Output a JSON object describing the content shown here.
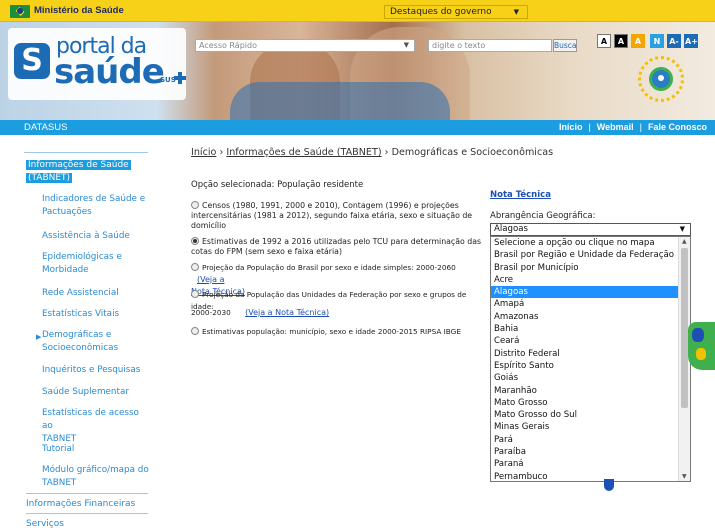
{
  "gov_bar": {
    "ministry": "Ministério da Saúde",
    "destaques": "Destaques do governo"
  },
  "header": {
    "logo_portal": "portal da",
    "logo_saude": "saúde",
    "logo_sus": "SUS",
    "search_placeholder": "Acesso Rápido",
    "digite_placeholder": "digite o texto",
    "busca_label": "Busca",
    "a11y": [
      "A",
      "A",
      "A",
      "N",
      "A-",
      "A+"
    ]
  },
  "datasus_bar": {
    "label": "DATASUS",
    "links": [
      "Início",
      "Webmail",
      "Fale Conosco"
    ]
  },
  "sidebar": {
    "main_item": [
      "Informações de Saúde",
      "(TABNET)"
    ],
    "items": [
      [
        "Indicadores de Saúde e",
        "Pactuações"
      ],
      [
        "Assistência à Saúde"
      ],
      [
        "Epidemiológicas e",
        "Morbidade"
      ],
      [
        "Rede Assistencial"
      ],
      [
        "Estatísticas Vitais"
      ],
      [
        "Demográficas e",
        "Socioeconômicas"
      ],
      [
        "Inquéritos e Pesquisas"
      ],
      [
        "Saúde Suplementar"
      ],
      [
        "Estatísticas de acesso ao",
        "TABNET"
      ],
      [
        "Tutorial"
      ],
      [
        "Módulo gráfico/mapa do",
        "TABNET"
      ]
    ],
    "financeiras": "Informações Financeiras",
    "servicos": "Serviços"
  },
  "breadcrumb": {
    "inicio": "Início",
    "sep": "›",
    "tabnet": "Informações de Saúde (TABNET)",
    "current": "Demográficas e Socioeconômicas"
  },
  "main": {
    "selected": "Opção selecionada: População residente",
    "options": [
      {
        "lines": [
          "Censos (1980, 1991, 2000 e 2010), Contagem (1996) e projeções",
          "intercensitárias (1981 a 2012), segundo faixa etária, sexo e situação de",
          "domicílio"
        ],
        "checked": false
      },
      {
        "lines": [
          "Estimativas de 1992 a 2016 utilizadas pelo TCU para determinação das",
          "cotas do FPM (sem sexo e faixa etária)"
        ],
        "checked": true
      },
      {
        "text": "Projeção da População do Brasil por sexo e idade simples: 2000-2060",
        "link": "(Veja a",
        "link2": "Nota Técnica)",
        "checked": false
      },
      {
        "text": "Projeção da População das Unidades da Federação por sexo e grupos de idade:",
        "text2": "2000-2030",
        "link": "(Veja a Nota Técnica)",
        "checked": false
      },
      {
        "text": "Estimativas população: município, sexo e idade 2000-2015 RIPSA IBGE",
        "checked": false
      }
    ],
    "nota_tecnica": "Nota Técnica",
    "abrangencia_label": "Abrangência Geográfica:",
    "select_value": "Alagoas",
    "dropdown": [
      "Selecione a opção ou clique no mapa",
      "Brasil por Região e Unidade da Federação",
      "Brasil por Município",
      "Acre",
      "Alagoas",
      "Amapá",
      "Amazonas",
      "Bahia",
      "Ceará",
      "Distrito Federal",
      "Espírito Santo",
      "Goiás",
      "Maranhão",
      "Mato Grosso",
      "Mato Grosso do Sul",
      "Minas Gerais",
      "Pará",
      "Paraíba",
      "Paraná",
      "Pernambuco"
    ],
    "dropdown_selected": "Alagoas"
  },
  "colors": {
    "accent": "#1c9de0",
    "gov_yellow": "#f7d117",
    "link": "#2a8ad2",
    "selected_option": "#1e90ff"
  }
}
